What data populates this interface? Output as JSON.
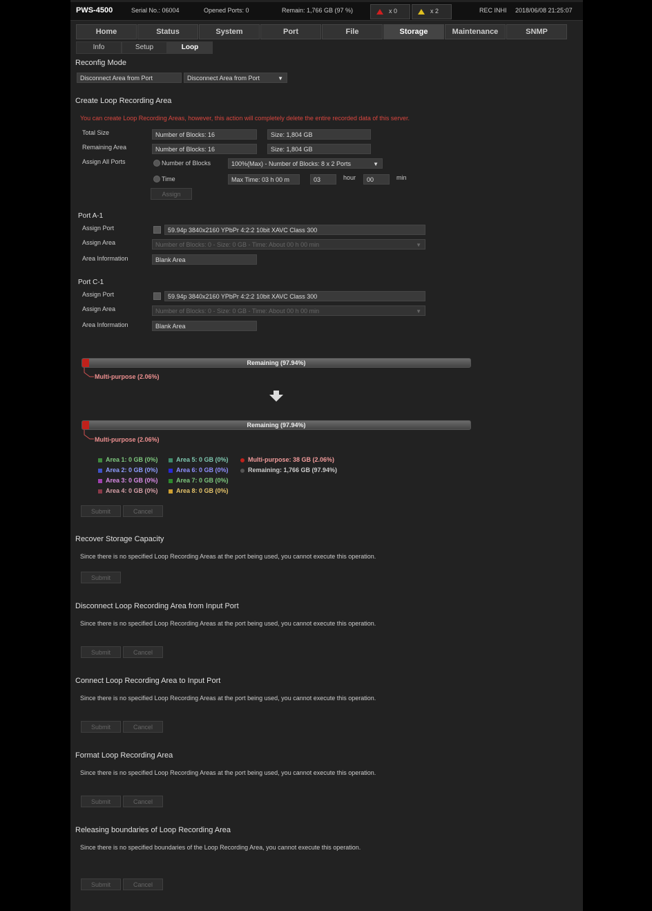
{
  "header": {
    "product": "PWS-4500",
    "serial": "Serial No.: 06004",
    "opened_ports": "Opened Ports: 0",
    "remain": "Remain: 1,766 GB (97 %)",
    "alert_count": "x 0",
    "warning_count": "x 2",
    "rec_status": "REC INHI",
    "datetime": "2018/06/08 21:25:07"
  },
  "tabs": [
    "Home",
    "Status",
    "System",
    "Port",
    "File",
    "Storage",
    "Maintenance",
    "SNMP"
  ],
  "subtabs": [
    "Info",
    "Setup",
    "Loop"
  ],
  "reconfig": {
    "title": "Reconfig Mode",
    "value": "Disconnect Area from Port",
    "select": "Disconnect Area from Port"
  },
  "create": {
    "title": "Create Loop Recording Area",
    "warning": "You can create Loop Recording Areas, however, this action will completely delete the entire recorded data of this server.",
    "total_size_label": "Total Size",
    "total_blocks": "Number of Blocks: 16",
    "total_size": "Size: 1,804 GB",
    "remaining_label": "Remaining Area",
    "remaining_blocks": "Number of Blocks: 16",
    "remaining_size": "Size: 1,804 GB",
    "assign_all_label": "Assign All Ports",
    "radio_blocks": "Number of Blocks",
    "blocks_select": "100%(Max) - Number of Blocks: 8 x 2 Ports",
    "radio_time": "Time",
    "max_time": "Max Time: 03 h 00 m",
    "hour_value": "03",
    "hour_label": "hour",
    "min_value": "00",
    "min_label": "min",
    "assign_button": "Assign"
  },
  "ports": [
    {
      "title": "Port A-1",
      "assign_port_label": "Assign Port",
      "format": "59.94p 3840x2160 YPbPr 4:2:2 10bit XAVC Class 300",
      "assign_area_label": "Assign Area",
      "area_select": "Number of Blocks: 0 - Size: 0 GB - Time: About 00 h 00 min",
      "info_label": "Area Information",
      "info_value": "Blank Area"
    },
    {
      "title": "Port C-1",
      "assign_port_label": "Assign Port",
      "format": "59.94p 3840x2160 YPbPr 4:2:2 10bit XAVC Class 300",
      "assign_area_label": "Assign Area",
      "area_select": "Number of Blocks: 0 - Size: 0 GB - Time: About 00 h 00 min",
      "info_label": "Area Information",
      "info_value": "Blank Area"
    }
  ],
  "usage": {
    "remaining_label": "Remaining (97.94%)",
    "multipurpose_label": "Multi-purpose (2.06%)",
    "multipurpose_fraction": 0.0206
  },
  "legend": [
    {
      "label": "Area 1: 0 GB (0%)",
      "color": "#3f8a3f"
    },
    {
      "label": "Area 2: 0 GB (0%)",
      "color": "#3f52c8"
    },
    {
      "label": "Area 3: 0 GB (0%)",
      "color": "#a040b0"
    },
    {
      "label": "Area 4: 0 GB (0%)",
      "color": "#8a3a48"
    },
    {
      "label": "Area 5: 0 GB (0%)",
      "color": "#3f8a6a"
    },
    {
      "label": "Area 6: 0 GB (0%)",
      "color": "#2828d8"
    },
    {
      "label": "Area 7: 0 GB (0%)",
      "color": "#2d8a2d"
    },
    {
      "label": "Area 8: 0 GB (0%)",
      "color": "#d0a030"
    },
    {
      "label": "Multi-purpose: 38 GB (2.06%)",
      "color": "#c0211b"
    },
    {
      "label": "Remaining: 1,766 GB (97.94%)",
      "color": "#555555"
    }
  ],
  "legend_text_colors": [
    "#7ec87e",
    "#8f9cff",
    "#d98be6",
    "#d6a0a8",
    "#7ec8b0",
    "#8f8fff",
    "#7ec87e",
    "#e6c46a",
    "#f09a9a",
    "#cccccc"
  ],
  "buttons": {
    "submit": "Submit",
    "cancel": "Cancel"
  },
  "sections": [
    {
      "title": "Recover Storage Capacity",
      "note": "Since there is no specified Loop Recording Areas at the port being used, you cannot execute this operation."
    },
    {
      "title": "Disconnect Loop Recording Area from Input Port",
      "note": "Since there is no specified Loop Recording Areas at the port being used, you cannot execute this operation."
    },
    {
      "title": "Connect Loop Recording Area to Input Port",
      "note": "Since there is no specified Loop Recording Areas at the port being used, you cannot execute this operation."
    },
    {
      "title": "Format Loop Recording Area",
      "note": "Since there is no specified Loop Recording Areas at the port being used, you cannot execute this operation."
    },
    {
      "title": "Releasing boundaries of Loop Recording Area",
      "note": "Since there is no specified boundaries of the Loop Recording Area, you cannot execute this operation."
    }
  ]
}
